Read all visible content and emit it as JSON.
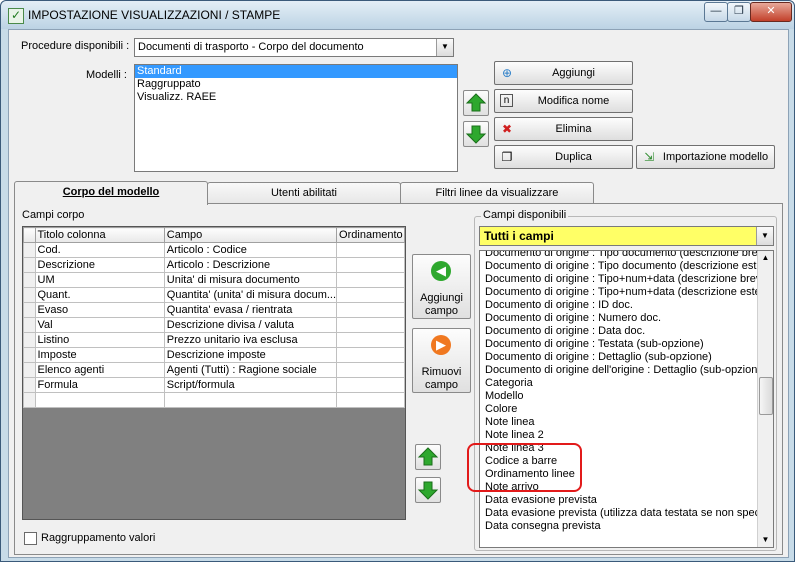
{
  "window": {
    "title": "IMPOSTAZIONE VISUALIZZAZIONI / STAMPE",
    "minimize_glyph": "—",
    "restore_glyph": "❐",
    "close_glyph": "✕"
  },
  "procedure": {
    "label": "Procedure disponibili :",
    "selected": "Documenti di trasporto - Corpo del documento"
  },
  "models": {
    "label": "Modelli :",
    "items": [
      "Standard",
      "Raggruppato",
      "Visualizz. RAEE"
    ],
    "selected_index": 0
  },
  "buttons": {
    "aggiungi": "Aggiungi",
    "modifica_nome": "Modifica nome",
    "elimina": "Elimina",
    "duplica": "Duplica",
    "importazione_modello": "Importazione modello"
  },
  "tabs": [
    {
      "label": "Corpo del modello",
      "active": true
    },
    {
      "label": "Utenti abilitati",
      "active": false
    },
    {
      "label": "Filtri linee da visualizzare",
      "active": false
    }
  ],
  "campi_corpo": {
    "label": "Campi corpo",
    "columns": [
      "Titolo colonna",
      "Campo",
      "Ordinamento"
    ],
    "rows": [
      [
        "Cod.",
        "Articolo : Codice",
        ""
      ],
      [
        "Descrizione",
        "Articolo : Descrizione",
        ""
      ],
      [
        "UM",
        "Unita' di misura documento",
        ""
      ],
      [
        "Quant.",
        "Quantita' (unita' di misura docum...",
        ""
      ],
      [
        "Evaso",
        "Quantita' evasa / rientrata",
        ""
      ],
      [
        "Val",
        "Descrizione divisa / valuta",
        ""
      ],
      [
        "Listino",
        "Prezzo unitario iva esclusa",
        ""
      ],
      [
        "Imposte",
        "Descrizione imposte",
        ""
      ],
      [
        "Elenco agenti",
        "Agenti (Tutti) : Ragione sociale",
        ""
      ],
      [
        "Formula",
        "Script/formula",
        ""
      ],
      [
        "",
        "",
        ""
      ]
    ]
  },
  "mid_buttons": {
    "aggiungi_line1": "Aggiungi",
    "aggiungi_line2": "campo",
    "rimuovi_line1": "Rimuovi",
    "rimuovi_line2": "campo"
  },
  "campi_disponibili": {
    "label": "Campi disponibili",
    "filter": "Tutti i campi",
    "items": [
      "Documento di origine : Tipo documento (descrizione breve",
      "Documento di origine : Tipo documento (descrizione estes",
      "Documento di origine : Tipo+num+data (descrizione breve",
      "Documento di origine : Tipo+num+data (descrizione estes",
      "Documento di origine : ID doc.",
      "Documento di origine : Numero doc.",
      "Documento di origine : Data doc.",
      "Documento di origine : Testata (sub-opzione)",
      "Documento di origine : Dettaglio (sub-opzione)",
      "Documento di origine dell'origine : Dettaglio (sub-opzione)",
      "Categoria",
      "Modello",
      "Colore",
      "Note linea",
      "Note linea 2",
      "Note linea 3",
      "Codice a barre",
      "Ordinamento linee",
      "Note arrivo",
      "Data evasione prevista",
      "Data evasione prevista (utilizza data testata se non specif",
      "Data consegna prevista"
    ]
  },
  "raggruppamento": {
    "label": "Raggruppamento valori",
    "checked": false
  },
  "colors": {
    "highlight_red": "#e21a1a",
    "selection_blue": "#3399ff",
    "filter_yellow": "#ffff66",
    "arrow_green": "#2ea82e"
  }
}
